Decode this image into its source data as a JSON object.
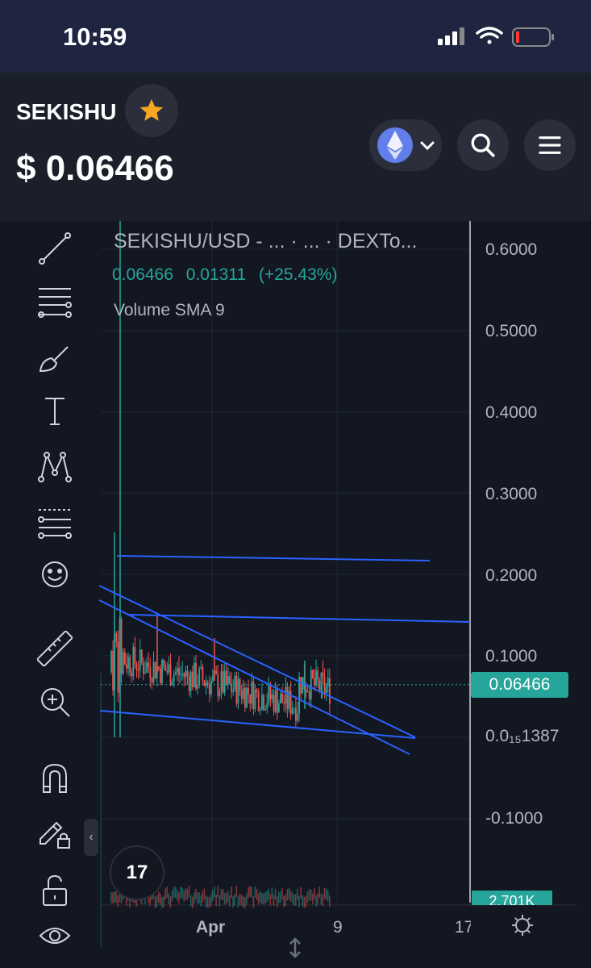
{
  "status_bar": {
    "time": "10:59"
  },
  "header": {
    "ticker": "SEKISHU",
    "price": "$ 0.06466",
    "chain_icon": "ethereum-icon",
    "colors": {
      "accent_star": "#f5a623",
      "background": "#1a1f2a"
    }
  },
  "toolbar": {
    "tools": [
      "trend-line-icon",
      "horizontal-lines-icon",
      "brush-icon",
      "text-icon",
      "pattern-icon",
      "fib-icon",
      "emoji-icon",
      "ruler-icon",
      "zoom-in-icon",
      "magnet-icon",
      "lock-drawing-icon",
      "unlock-icon",
      "eye-icon"
    ]
  },
  "legend": {
    "title": "SEKISHU/USD - ... · ... · DEXTo...",
    "open_price": "0.06466",
    "change": "0.01311",
    "change_pct": "(+25.43%)",
    "indicator": "Volume SMA 9"
  },
  "price_axis": {
    "labels": [
      "0.6000",
      "0.5000",
      "0.4000",
      "0.3000",
      "0.2000",
      "0.1000",
      "0.0₁₅1387",
      "-0.1000"
    ],
    "current_price_tag": "0.06466",
    "volume_tag": "2.701K"
  },
  "time_axis": {
    "labels": [
      "Apr",
      "9",
      "17"
    ]
  },
  "logo": {
    "text": "17"
  },
  "chart_data": {
    "type": "candlestick",
    "y_min": -0.15,
    "y_max": 0.65,
    "current_price": 0.06466,
    "colors": {
      "up": "#26a69a",
      "down": "#ef5350",
      "trendline": "#2962ff"
    }
  }
}
